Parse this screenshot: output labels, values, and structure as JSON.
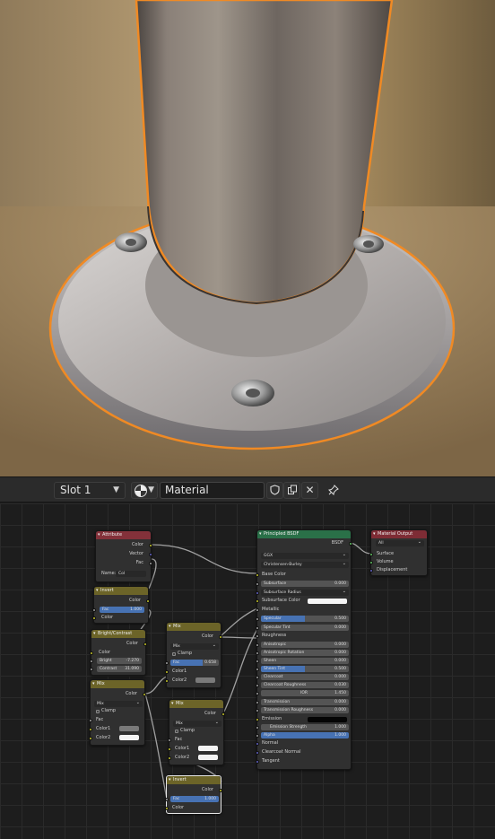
{
  "header": {
    "slot_label": "Slot 1",
    "material_name": "Material",
    "icons": [
      "material-ball-icon",
      "fake-user-shield-icon",
      "duplicate-icon",
      "unlink-x-icon",
      "pin-icon"
    ]
  },
  "nodes": {
    "attribute": {
      "title": "Attribute",
      "out_color": "Color",
      "out_vector": "Vector",
      "out_fac": "Fac",
      "name_label": "Name:",
      "name_value": "Col"
    },
    "invert1": {
      "title": "Invert",
      "out_color": "Color",
      "fac_label": "Fac",
      "fac_value": "1.000",
      "in_color": "Color"
    },
    "bright_contrast": {
      "title": "Bright/Contrast",
      "out_color": "Color",
      "in_color": "Color",
      "bright_label": "Bright",
      "bright_value": "-7.270",
      "contrast_label": "Contrast",
      "contrast_value": "31.090"
    },
    "mix1": {
      "title": "Mix",
      "out_color": "Color",
      "blend": "Mix",
      "clamp": "Clamp",
      "fac": "Fac",
      "color1": "Color1",
      "color2": "Color2"
    },
    "mix2": {
      "title": "Mix",
      "out_color": "Color",
      "blend": "Mix",
      "clamp": "Clamp",
      "fac_label": "Fac",
      "fac_value": "0.658",
      "color1": "Color1",
      "color2": "Color2"
    },
    "mix3": {
      "title": "Mix",
      "out_color": "Color",
      "blend": "Mix",
      "clamp": "Clamp",
      "fac": "Fac",
      "color1": "Color1",
      "color2": "Color2"
    },
    "invert2": {
      "title": "Invert",
      "out_color": "Color",
      "fac_label": "Fac",
      "fac_value": "1.000",
      "in_color": "Color"
    },
    "principled": {
      "title": "Principled BSDF",
      "out_bsdf": "BSDF",
      "distribution": "GGX",
      "subsurface_method": "Christensen-Burley",
      "base_color": "Base Color",
      "subsurface": {
        "label": "Subsurface",
        "value": "0.000"
      },
      "subsurface_radius": "Subsurface Radius",
      "subsurface_color": "Subsurface Color",
      "metallic": "Metallic",
      "specular": {
        "label": "Specular",
        "value": "0.500",
        "fill": 0.5
      },
      "specular_tint": {
        "label": "Specular Tint",
        "value": "0.000"
      },
      "roughness": "Roughness",
      "anisotropic": {
        "label": "Anisotropic",
        "value": "0.000"
      },
      "anisotropic_rotation": {
        "label": "Anisotropic Rotation",
        "value": "0.000"
      },
      "sheen": {
        "label": "Sheen",
        "value": "0.000"
      },
      "sheen_tint": {
        "label": "Sheen Tint",
        "value": "0.500",
        "fill": 0.5
      },
      "clearcoat": {
        "label": "Clearcoat",
        "value": "0.000"
      },
      "clearcoat_roughness": {
        "label": "Clearcoat Roughness",
        "value": "0.030"
      },
      "ior": {
        "label": "IOR",
        "value": "1.450"
      },
      "transmission": {
        "label": "Transmission",
        "value": "0.000"
      },
      "transmission_roughness": {
        "label": "Transmission Roughness",
        "value": "0.000"
      },
      "emission": "Emission",
      "emission_strength": {
        "label": "Emission Strength",
        "value": "1.000"
      },
      "alpha": {
        "label": "Alpha",
        "value": "1.000",
        "fill": 1.0
      },
      "normal": "Normal",
      "clearcoat_normal": "Clearcoat Normal",
      "tangent": "Tangent"
    },
    "material_output": {
      "title": "Material Output",
      "target": "All",
      "surface": "Surface",
      "volume": "Volume",
      "displacement": "Displacement"
    }
  },
  "colors": {
    "selection_outline": "#f08a24",
    "shader_header": "#2a7048",
    "color_header": "#6c6428",
    "attribute_header": "#83313a",
    "value_bar": "#4772b3"
  }
}
